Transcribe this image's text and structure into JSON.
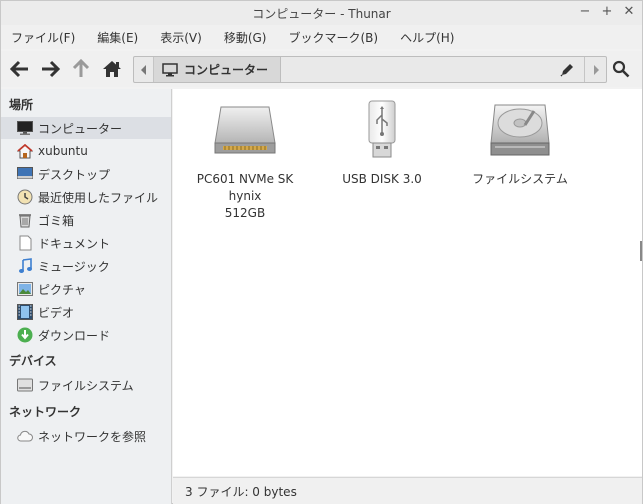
{
  "window": {
    "title": "コンピューター - Thunar",
    "controls": [
      "minimize-icon",
      "maximize-icon",
      "close-icon"
    ]
  },
  "menubar": {
    "items": [
      "ファイル(F)",
      "編集(E)",
      "表示(V)",
      "移動(G)",
      "ブックマーク(B)",
      "ヘルプ(H)"
    ]
  },
  "toolbar": {
    "buttons": [
      "back-arrow-icon",
      "forward-arrow-icon",
      "up-arrow-icon",
      "home-icon"
    ],
    "path": {
      "current": "コンピューター",
      "icon": "monitor-icon"
    },
    "edit_icon": "pencil-icon",
    "search_icon": "search-icon"
  },
  "sidebar": {
    "places_header": "場所",
    "places": [
      {
        "label": "コンピューター",
        "icon": "monitor-icon",
        "selected": true
      },
      {
        "label": "xubuntu",
        "icon": "home-icon"
      },
      {
        "label": "デスクトップ",
        "icon": "desktop-icon"
      },
      {
        "label": "最近使用したファイル",
        "icon": "clock-icon"
      },
      {
        "label": "ゴミ箱",
        "icon": "trash-icon"
      },
      {
        "label": "ドキュメント",
        "icon": "document-icon"
      },
      {
        "label": "ミュージック",
        "icon": "music-icon"
      },
      {
        "label": "ピクチャ",
        "icon": "pictures-icon"
      },
      {
        "label": "ビデオ",
        "icon": "video-icon"
      },
      {
        "label": "ダウンロード",
        "icon": "download-icon"
      }
    ],
    "devices_header": "デバイス",
    "devices": [
      {
        "label": "ファイルシステム",
        "icon": "harddisk-icon"
      }
    ],
    "network_header": "ネットワーク",
    "network": [
      {
        "label": "ネットワークを参照",
        "icon": "cloud-icon"
      }
    ]
  },
  "content": {
    "items": [
      {
        "label_line1": "PC601 NVMe SK hynix",
        "label_line2": "512GB",
        "icon": "drive-icon"
      },
      {
        "label_line1": "USB DISK 3.0",
        "label_line2": "",
        "icon": "usb-icon"
      },
      {
        "label_line1": "ファイルシステム",
        "label_line2": "",
        "icon": "harddisk-icon"
      }
    ]
  },
  "statusbar": {
    "text": "3 ファイル: 0 bytes"
  },
  "colors": {
    "selected_bg": "#dcdfe4",
    "sidebar_bg": "#eef0f2",
    "toolbar_bg": "#f0f0f0",
    "download_green": "#4caf50",
    "music_blue": "#3d7fd0"
  }
}
